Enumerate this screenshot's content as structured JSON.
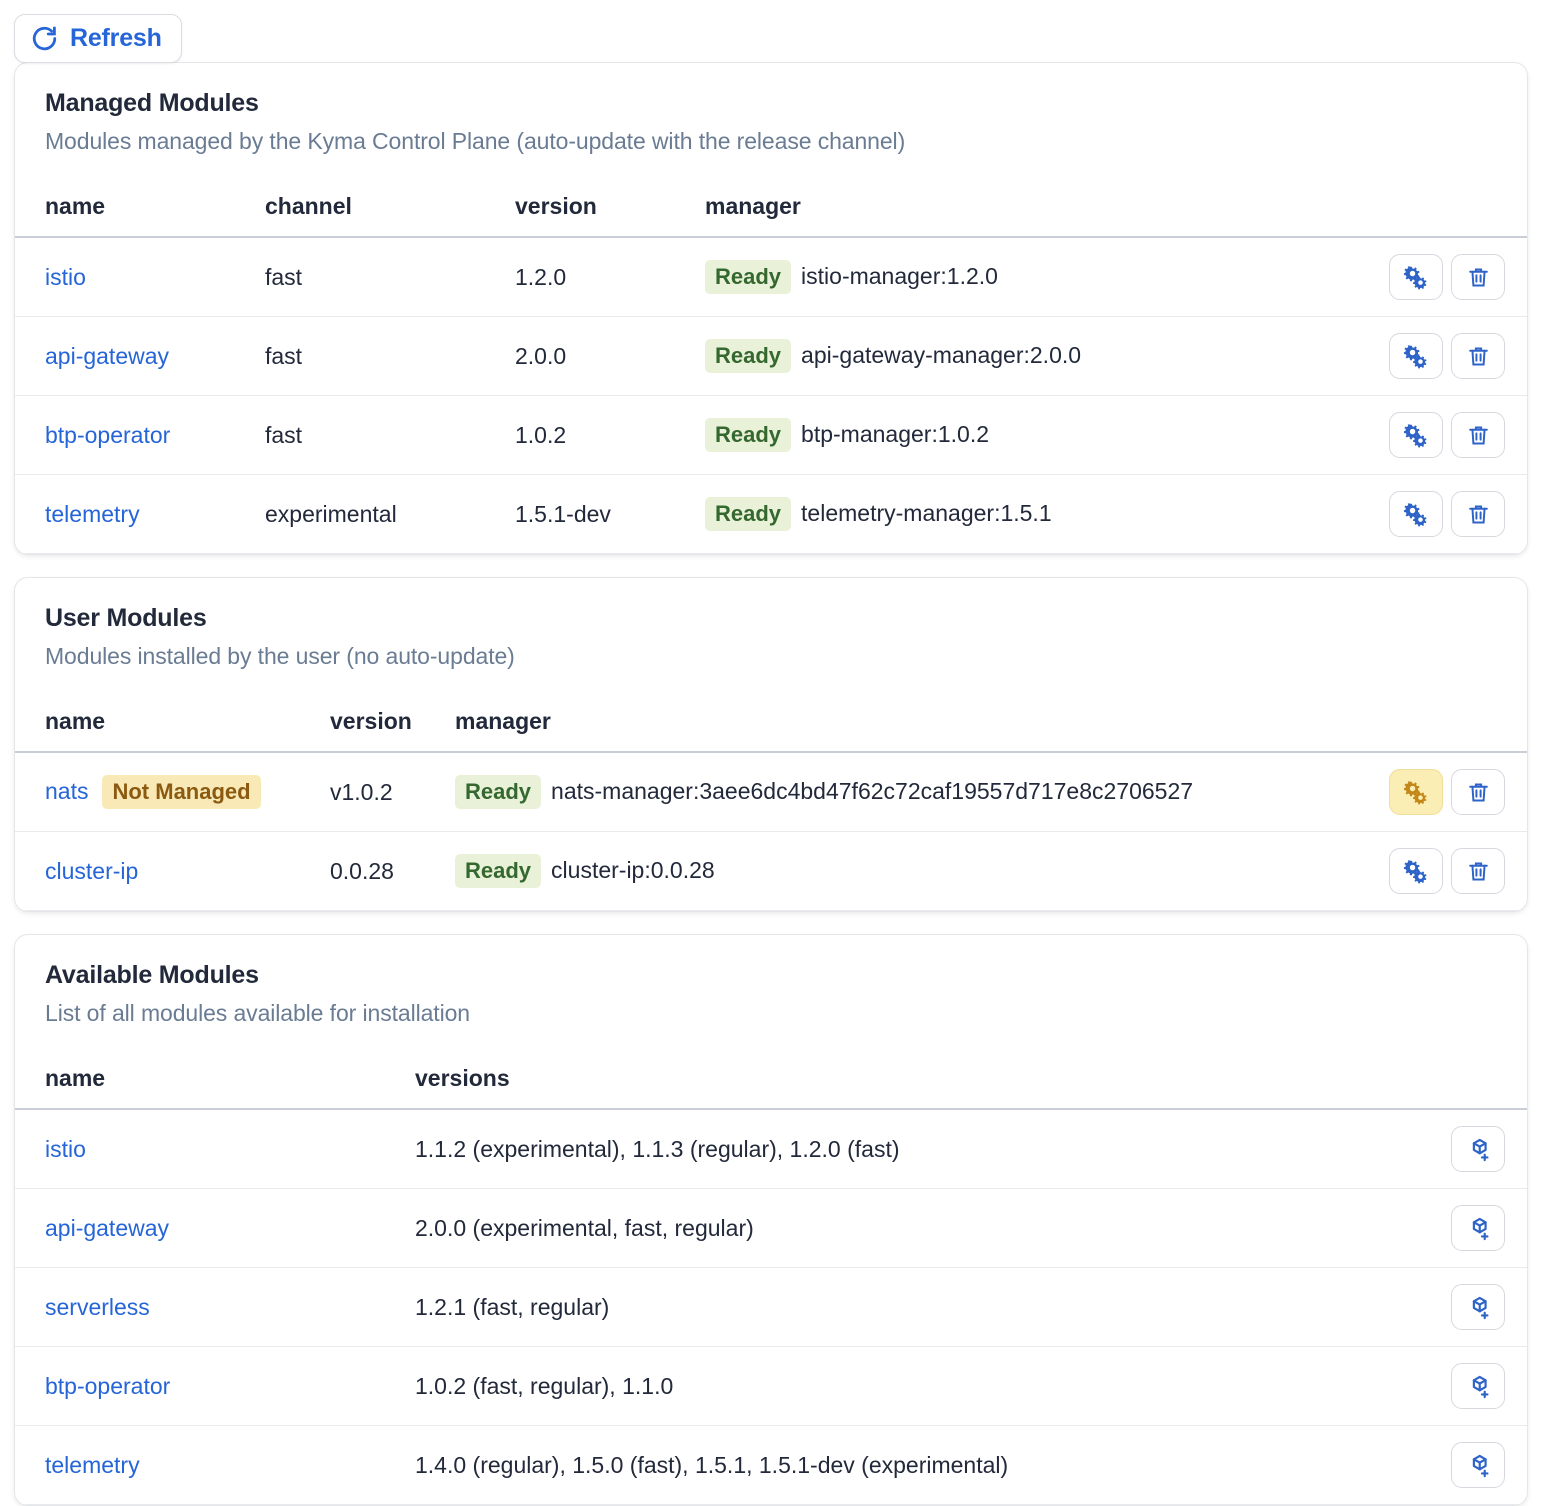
{
  "toolbar": {
    "refresh_label": "Refresh",
    "refresh_icon": "refresh-circular-arrow-icon"
  },
  "colors": {
    "link": "#2565d8",
    "badge_ready_bg": "#e9f2d9",
    "badge_ready_text": "#35682f",
    "badge_notmanaged_bg": "#f9e9b7",
    "badge_notmanaged_text": "#8b5a10",
    "icon_blue": "#2e63c8",
    "highlight_bg": "#fbeeb4"
  },
  "managed_modules": {
    "title": "Managed Modules",
    "subtitle": "Modules managed by the Kyma Control Plane (auto-update with the release channel)",
    "columns": [
      "name",
      "channel",
      "version",
      "manager"
    ],
    "rows": [
      {
        "name": "istio",
        "channel": "fast",
        "version": "1.2.0",
        "status": "Ready",
        "manager": "istio-manager:1.2.0",
        "settings_highlight": false
      },
      {
        "name": "api-gateway",
        "channel": "fast",
        "version": "2.0.0",
        "status": "Ready",
        "manager": "api-gateway-manager:2.0.0",
        "settings_highlight": false
      },
      {
        "name": "btp-operator",
        "channel": "fast",
        "version": "1.0.2",
        "status": "Ready",
        "manager": "btp-manager:1.0.2",
        "settings_highlight": false
      },
      {
        "name": "telemetry",
        "channel": "experimental",
        "version": "1.5.1-dev",
        "status": "Ready",
        "manager": "telemetry-manager:1.5.1",
        "settings_highlight": false
      }
    ],
    "row_actions": [
      "settings-gears-icon",
      "delete-trash-icon"
    ]
  },
  "user_modules": {
    "title": "User Modules",
    "subtitle": "Modules installed by the user (no auto-update)",
    "columns": [
      "name",
      "version",
      "manager"
    ],
    "rows": [
      {
        "name": "nats",
        "tag": "Not Managed",
        "version": "v1.0.2",
        "status": "Ready",
        "manager": "nats-manager:3aee6dc4bd47f62c72caf19557d717e8c2706527",
        "settings_highlight": true
      },
      {
        "name": "cluster-ip",
        "tag": "",
        "version": "0.0.28",
        "status": "Ready",
        "manager": "cluster-ip:0.0.28",
        "settings_highlight": false
      }
    ],
    "row_actions": [
      "settings-gears-icon",
      "delete-trash-icon"
    ]
  },
  "available_modules": {
    "title": "Available Modules",
    "subtitle": "List of all modules available for installation",
    "columns": [
      "name",
      "versions"
    ],
    "rows": [
      {
        "name": "istio",
        "versions": "1.1.2 (experimental), 1.1.3 (regular), 1.2.0 (fast)"
      },
      {
        "name": "api-gateway",
        "versions": "2.0.0 (experimental, fast, regular)"
      },
      {
        "name": "serverless",
        "versions": "1.2.1 (fast, regular)"
      },
      {
        "name": "btp-operator",
        "versions": "1.0.2 (fast, regular), 1.1.0"
      },
      {
        "name": "telemetry",
        "versions": "1.4.0 (regular), 1.5.0 (fast), 1.5.1, 1.5.1-dev (experimental)"
      }
    ],
    "row_actions": [
      "add-module-icon"
    ]
  }
}
